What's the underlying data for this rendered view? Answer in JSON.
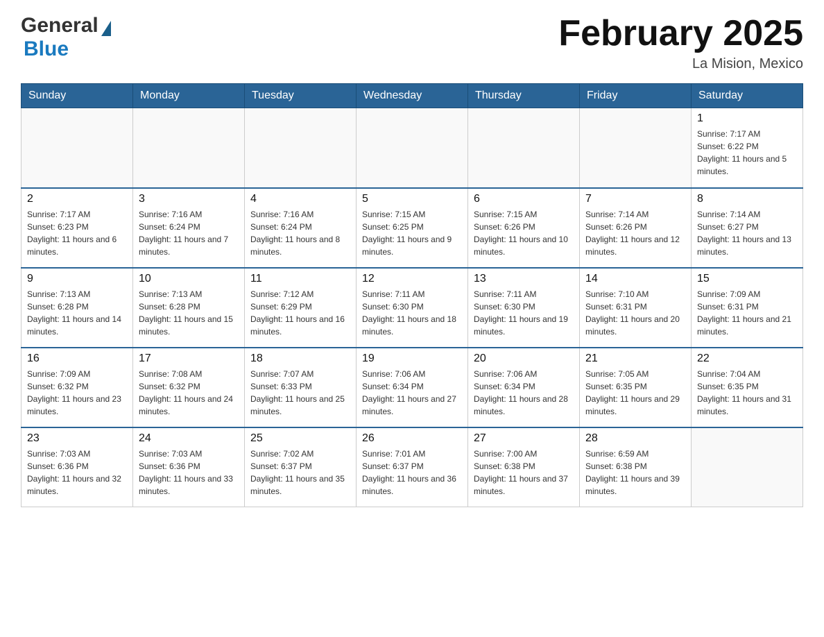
{
  "header": {
    "logo_general": "General",
    "logo_blue": "Blue",
    "month_title": "February 2025",
    "location": "La Mision, Mexico"
  },
  "weekdays": [
    "Sunday",
    "Monday",
    "Tuesday",
    "Wednesday",
    "Thursday",
    "Friday",
    "Saturday"
  ],
  "weeks": [
    [
      {
        "day": "",
        "sunrise": "",
        "sunset": "",
        "daylight": ""
      },
      {
        "day": "",
        "sunrise": "",
        "sunset": "",
        "daylight": ""
      },
      {
        "day": "",
        "sunrise": "",
        "sunset": "",
        "daylight": ""
      },
      {
        "day": "",
        "sunrise": "",
        "sunset": "",
        "daylight": ""
      },
      {
        "day": "",
        "sunrise": "",
        "sunset": "",
        "daylight": ""
      },
      {
        "day": "",
        "sunrise": "",
        "sunset": "",
        "daylight": ""
      },
      {
        "day": "1",
        "sunrise": "Sunrise: 7:17 AM",
        "sunset": "Sunset: 6:22 PM",
        "daylight": "Daylight: 11 hours and 5 minutes."
      }
    ],
    [
      {
        "day": "2",
        "sunrise": "Sunrise: 7:17 AM",
        "sunset": "Sunset: 6:23 PM",
        "daylight": "Daylight: 11 hours and 6 minutes."
      },
      {
        "day": "3",
        "sunrise": "Sunrise: 7:16 AM",
        "sunset": "Sunset: 6:24 PM",
        "daylight": "Daylight: 11 hours and 7 minutes."
      },
      {
        "day": "4",
        "sunrise": "Sunrise: 7:16 AM",
        "sunset": "Sunset: 6:24 PM",
        "daylight": "Daylight: 11 hours and 8 minutes."
      },
      {
        "day": "5",
        "sunrise": "Sunrise: 7:15 AM",
        "sunset": "Sunset: 6:25 PM",
        "daylight": "Daylight: 11 hours and 9 minutes."
      },
      {
        "day": "6",
        "sunrise": "Sunrise: 7:15 AM",
        "sunset": "Sunset: 6:26 PM",
        "daylight": "Daylight: 11 hours and 10 minutes."
      },
      {
        "day": "7",
        "sunrise": "Sunrise: 7:14 AM",
        "sunset": "Sunset: 6:26 PM",
        "daylight": "Daylight: 11 hours and 12 minutes."
      },
      {
        "day": "8",
        "sunrise": "Sunrise: 7:14 AM",
        "sunset": "Sunset: 6:27 PM",
        "daylight": "Daylight: 11 hours and 13 minutes."
      }
    ],
    [
      {
        "day": "9",
        "sunrise": "Sunrise: 7:13 AM",
        "sunset": "Sunset: 6:28 PM",
        "daylight": "Daylight: 11 hours and 14 minutes."
      },
      {
        "day": "10",
        "sunrise": "Sunrise: 7:13 AM",
        "sunset": "Sunset: 6:28 PM",
        "daylight": "Daylight: 11 hours and 15 minutes."
      },
      {
        "day": "11",
        "sunrise": "Sunrise: 7:12 AM",
        "sunset": "Sunset: 6:29 PM",
        "daylight": "Daylight: 11 hours and 16 minutes."
      },
      {
        "day": "12",
        "sunrise": "Sunrise: 7:11 AM",
        "sunset": "Sunset: 6:30 PM",
        "daylight": "Daylight: 11 hours and 18 minutes."
      },
      {
        "day": "13",
        "sunrise": "Sunrise: 7:11 AM",
        "sunset": "Sunset: 6:30 PM",
        "daylight": "Daylight: 11 hours and 19 minutes."
      },
      {
        "day": "14",
        "sunrise": "Sunrise: 7:10 AM",
        "sunset": "Sunset: 6:31 PM",
        "daylight": "Daylight: 11 hours and 20 minutes."
      },
      {
        "day": "15",
        "sunrise": "Sunrise: 7:09 AM",
        "sunset": "Sunset: 6:31 PM",
        "daylight": "Daylight: 11 hours and 21 minutes."
      }
    ],
    [
      {
        "day": "16",
        "sunrise": "Sunrise: 7:09 AM",
        "sunset": "Sunset: 6:32 PM",
        "daylight": "Daylight: 11 hours and 23 minutes."
      },
      {
        "day": "17",
        "sunrise": "Sunrise: 7:08 AM",
        "sunset": "Sunset: 6:32 PM",
        "daylight": "Daylight: 11 hours and 24 minutes."
      },
      {
        "day": "18",
        "sunrise": "Sunrise: 7:07 AM",
        "sunset": "Sunset: 6:33 PM",
        "daylight": "Daylight: 11 hours and 25 minutes."
      },
      {
        "day": "19",
        "sunrise": "Sunrise: 7:06 AM",
        "sunset": "Sunset: 6:34 PM",
        "daylight": "Daylight: 11 hours and 27 minutes."
      },
      {
        "day": "20",
        "sunrise": "Sunrise: 7:06 AM",
        "sunset": "Sunset: 6:34 PM",
        "daylight": "Daylight: 11 hours and 28 minutes."
      },
      {
        "day": "21",
        "sunrise": "Sunrise: 7:05 AM",
        "sunset": "Sunset: 6:35 PM",
        "daylight": "Daylight: 11 hours and 29 minutes."
      },
      {
        "day": "22",
        "sunrise": "Sunrise: 7:04 AM",
        "sunset": "Sunset: 6:35 PM",
        "daylight": "Daylight: 11 hours and 31 minutes."
      }
    ],
    [
      {
        "day": "23",
        "sunrise": "Sunrise: 7:03 AM",
        "sunset": "Sunset: 6:36 PM",
        "daylight": "Daylight: 11 hours and 32 minutes."
      },
      {
        "day": "24",
        "sunrise": "Sunrise: 7:03 AM",
        "sunset": "Sunset: 6:36 PM",
        "daylight": "Daylight: 11 hours and 33 minutes."
      },
      {
        "day": "25",
        "sunrise": "Sunrise: 7:02 AM",
        "sunset": "Sunset: 6:37 PM",
        "daylight": "Daylight: 11 hours and 35 minutes."
      },
      {
        "day": "26",
        "sunrise": "Sunrise: 7:01 AM",
        "sunset": "Sunset: 6:37 PM",
        "daylight": "Daylight: 11 hours and 36 minutes."
      },
      {
        "day": "27",
        "sunrise": "Sunrise: 7:00 AM",
        "sunset": "Sunset: 6:38 PM",
        "daylight": "Daylight: 11 hours and 37 minutes."
      },
      {
        "day": "28",
        "sunrise": "Sunrise: 6:59 AM",
        "sunset": "Sunset: 6:38 PM",
        "daylight": "Daylight: 11 hours and 39 minutes."
      },
      {
        "day": "",
        "sunrise": "",
        "sunset": "",
        "daylight": ""
      }
    ]
  ]
}
